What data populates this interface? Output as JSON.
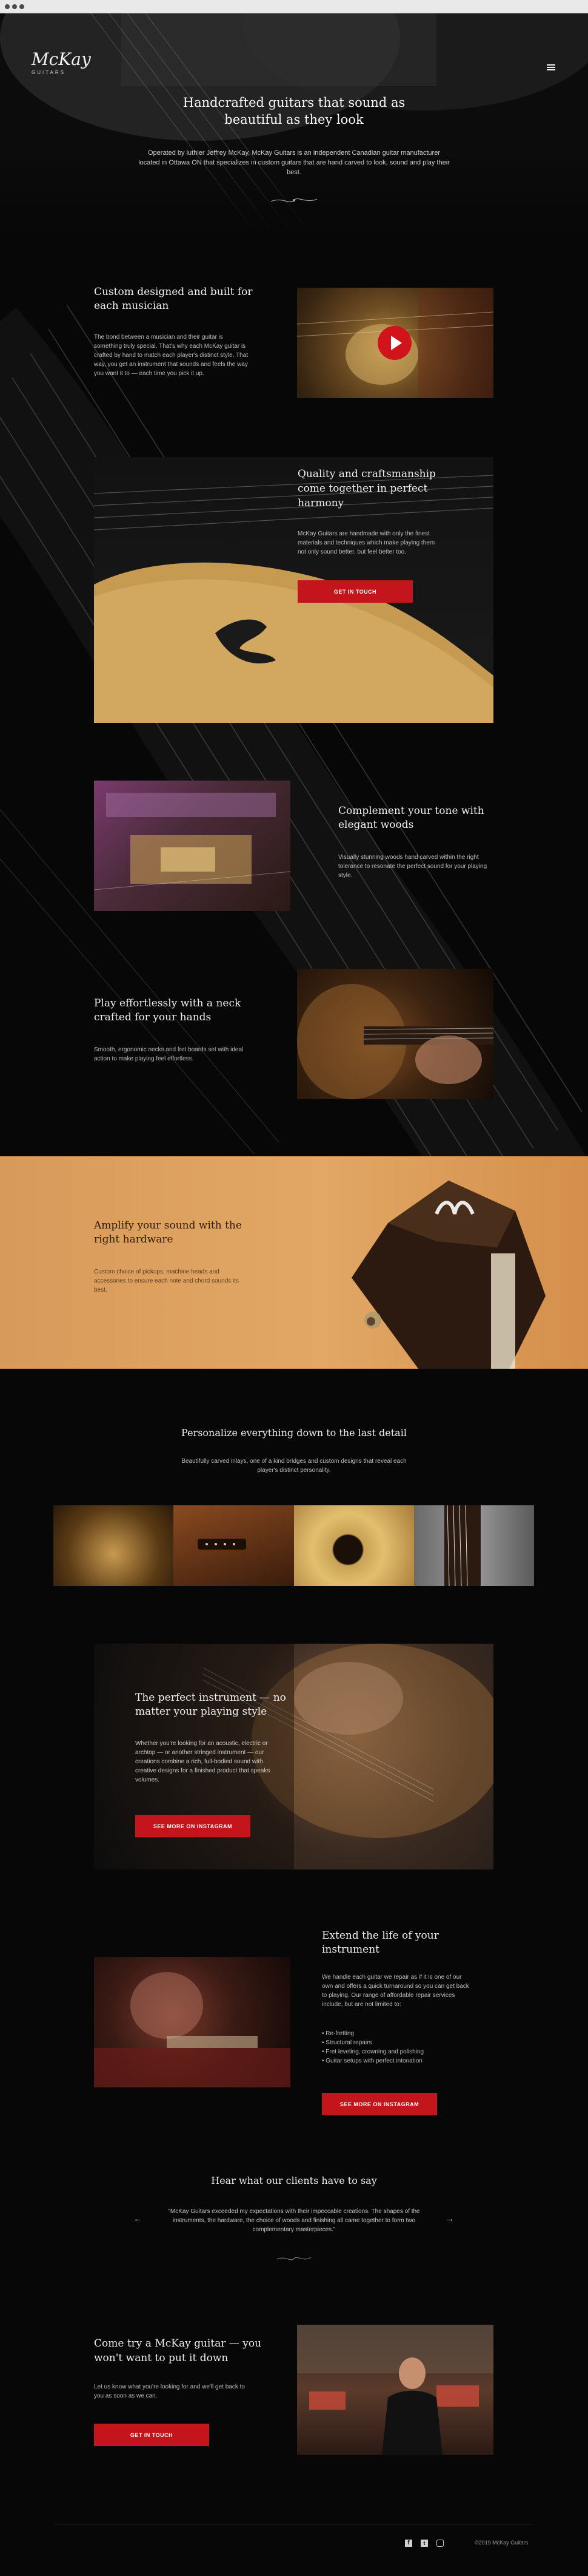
{
  "brand": {
    "name": "McKay",
    "sub": "GUITARS"
  },
  "hero": {
    "title": "Handcrafted guitars that sound as beautiful as they look",
    "text": "Operated by luthier Jeffrey McKay, McKay Guitars is an independent Canadian guitar manufacturer located in Ottawa ON that specializes in custom guitars that are hand carved to look, sound and play their best."
  },
  "s1": {
    "title": "Custom designed and built for each musician",
    "text": "The bond between a musician and their guitar is something truly special. That's why each McKay guitar is crafted by hand to match each player's distinct style. That way, you get an instrument that sounds and feels the way you want it to — each time you pick it up."
  },
  "s2": {
    "title": "Quality and craftsmanship come together in perfect harmony",
    "text": "McKay Guitars are handmade with only the finest materials and techniques which make playing them not only sound better, but feel better too.",
    "button": "GET IN TOUCH"
  },
  "s3": {
    "title": "Complement your tone with elegant woods",
    "text": "Visually stunning woods hand carved within the right tolerance to resonate the perfect sound for your playing style."
  },
  "s4": {
    "title": "Play effortlessly with a neck crafted for your hands",
    "text": "Smooth, ergonomic necks and fret boards set with ideal action to make playing feel effortless."
  },
  "s5": {
    "title": "Amplify your sound with the right hardware",
    "text": "Custom choice of pickups, machine heads and accessories to ensure each note and chord sounds its best."
  },
  "s6": {
    "title": "Personalize everything down to the last detail",
    "text": "Beautifully carved inlays, one of a kind bridges and custom designs that reveal each player's distinct personality."
  },
  "s7": {
    "title": "The perfect instrument — no matter your playing style",
    "text": "Whether you're looking for an acoustic, electric or archtop — or another stringed instrument — our creations combine a rich, full-bodied sound with creative designs for a finished product that speaks volumes.",
    "button": "SEE MORE ON INSTAGRAM"
  },
  "s8": {
    "title": "Extend the life of your instrument",
    "text": "We handle each guitar we repair as if it is one of our own and offers a quick turnaround so you can get back to playing. Our range of affordable repair services include, but are not limited to:",
    "list": [
      "Re-fretting",
      "Structural repairs",
      "Fret leveling, crowning and polishing",
      "Guitar setups with perfect intonation"
    ],
    "button": "SEE MORE ON INSTAGRAM"
  },
  "testimonial": {
    "title": "Hear what our clients have to say",
    "quote": "\"McKay Guitars exceeded my expectations with their impeccable creations. The shapes of the instruments, the hardware, the choice of woods and finishing all came together to form two complementary masterpieces.\""
  },
  "cta": {
    "title": "Come try a McKay guitar — you won't want to put it down",
    "text": "Let us know what you're looking for and we'll get back to you as soon as we can.",
    "button": "GET IN TOUCH"
  },
  "footer": {
    "copyright": "©2019 McKay Guitars"
  },
  "colors": {
    "accent": "#c4151c",
    "background": "#070707",
    "orange": "#e2a765"
  },
  "icons": [
    "menu-icon",
    "play-icon",
    "arrow-left-icon",
    "arrow-right-icon",
    "facebook-icon",
    "twitter-icon",
    "instagram-icon"
  ]
}
